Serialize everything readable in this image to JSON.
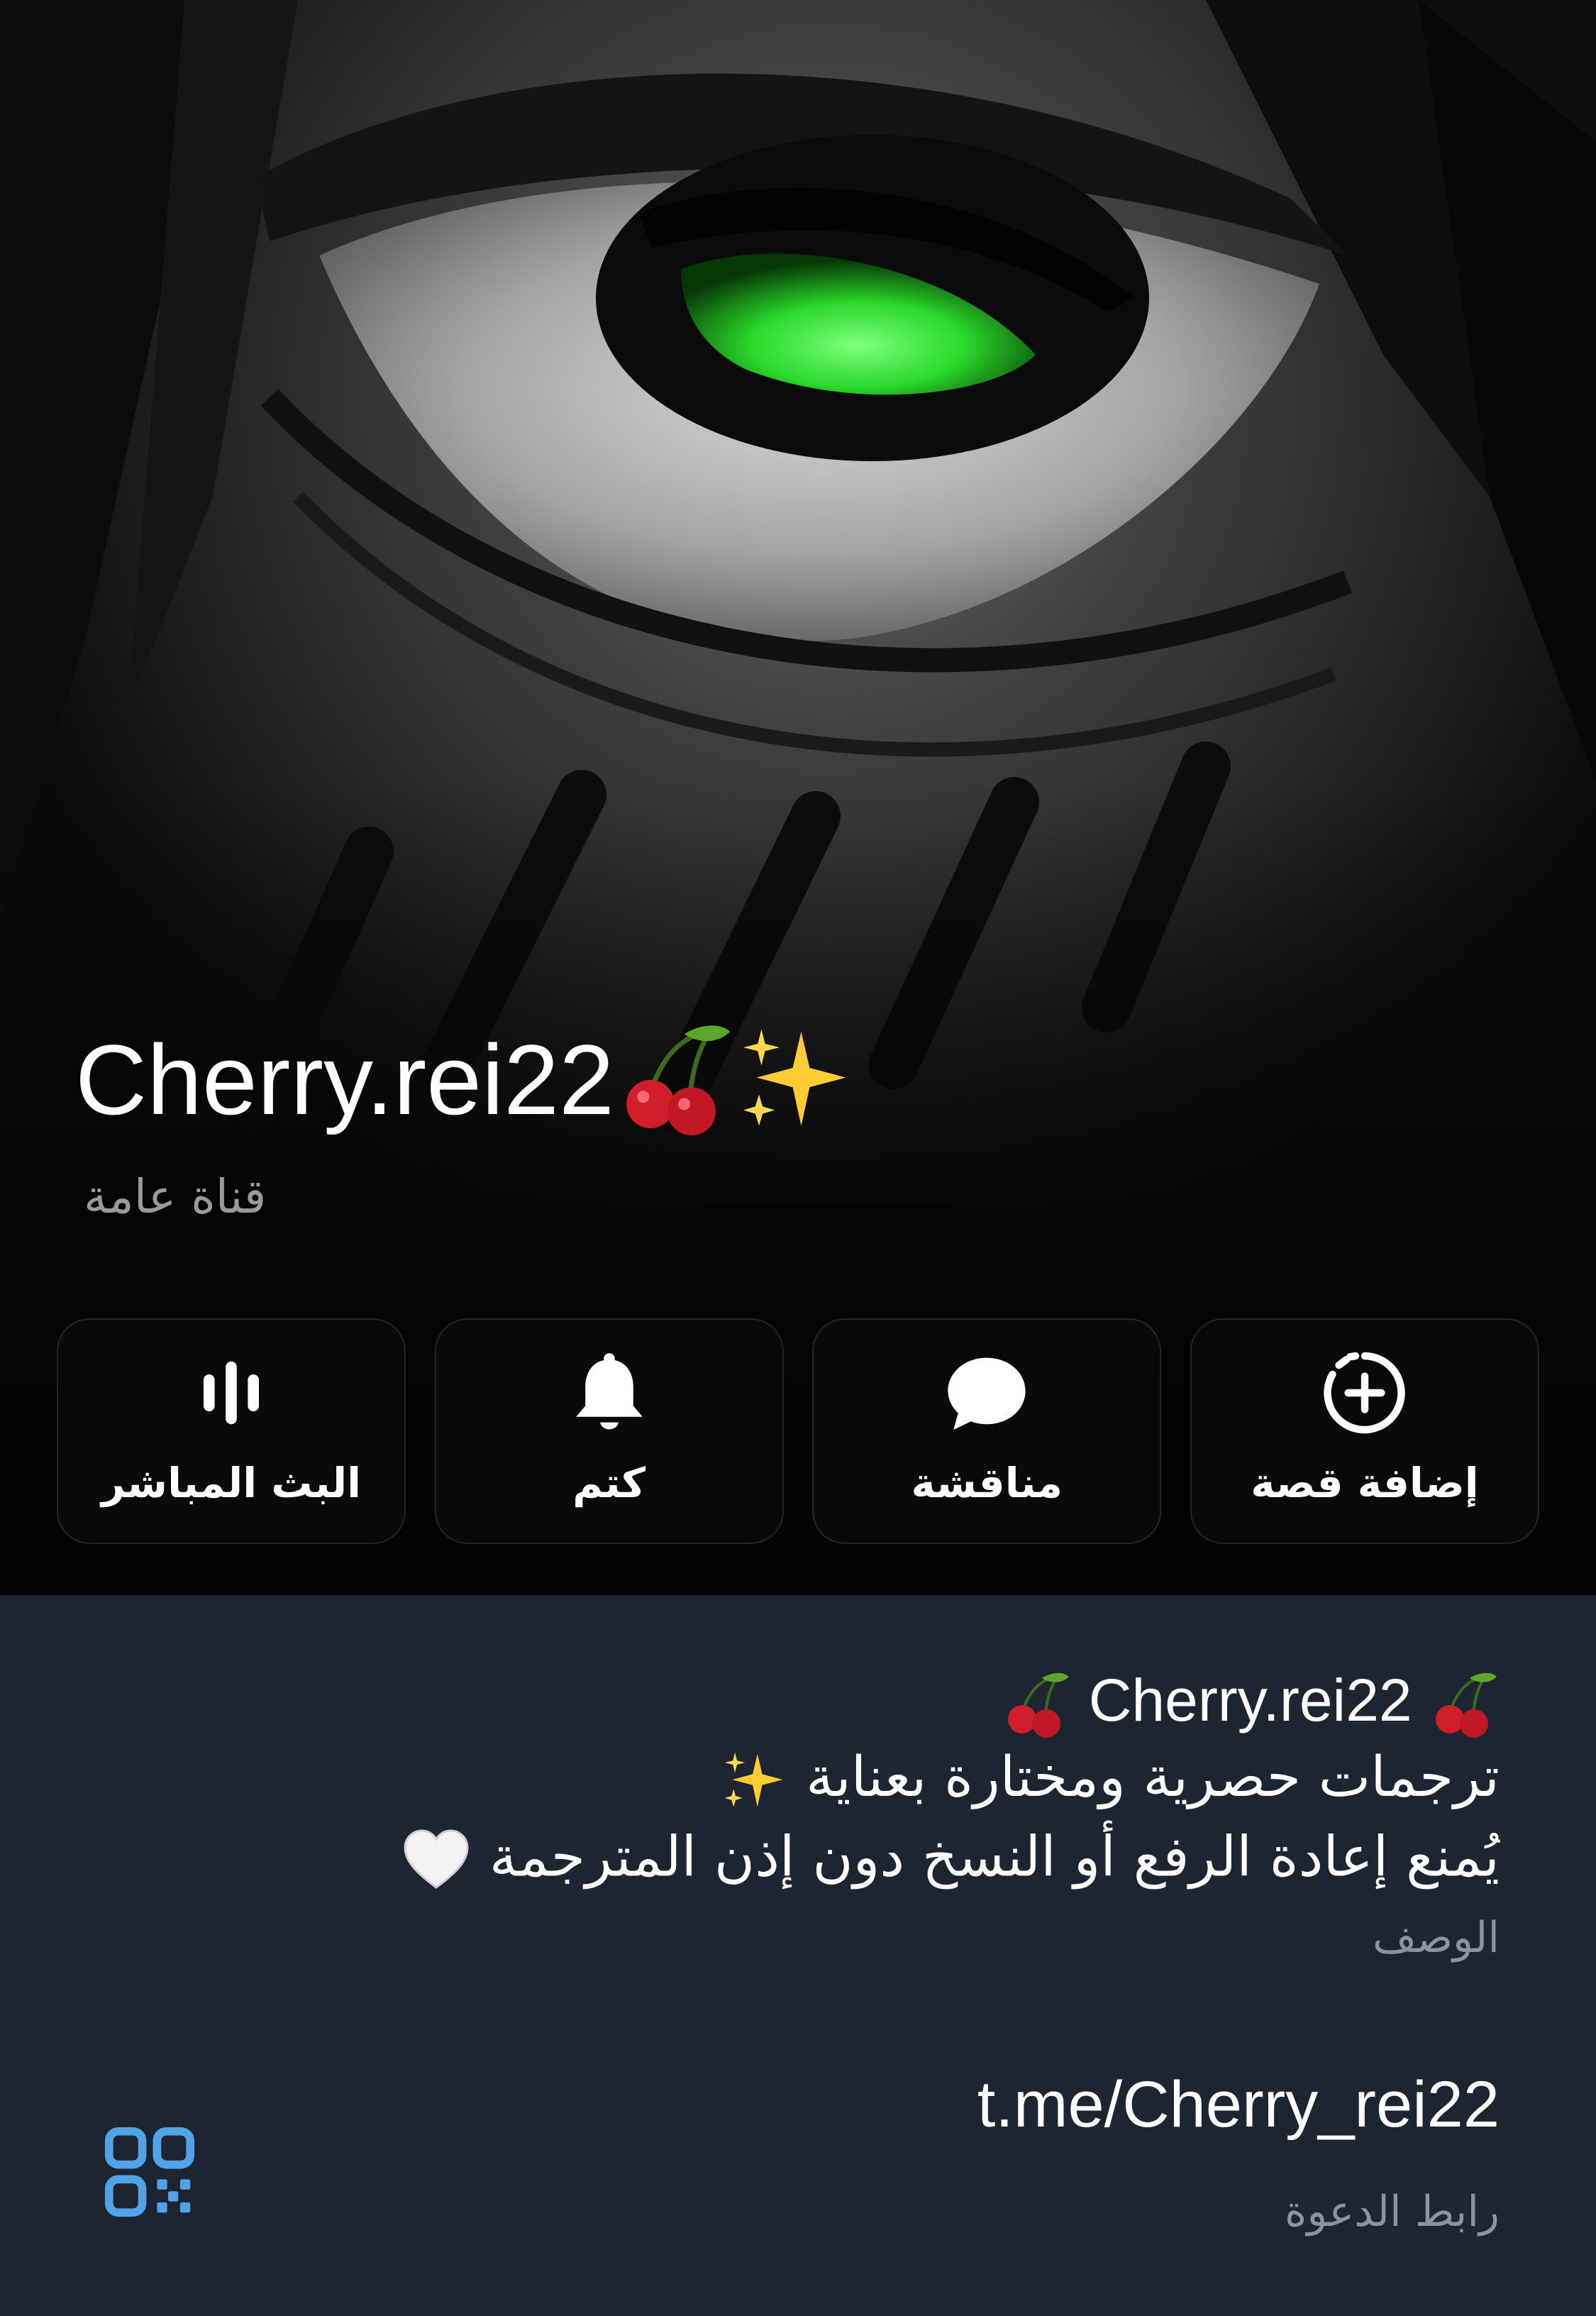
{
  "channel": {
    "name": "Cherry.rei22",
    "type_label": "قناة عامة",
    "title_emojis": [
      "cherry-emoji",
      "sparkles-emoji"
    ]
  },
  "actions": [
    {
      "label": "البث المباشر",
      "icon": "live-stream-icon"
    },
    {
      "label": "كتم",
      "icon": "bell-icon"
    },
    {
      "label": "مناقشة",
      "icon": "chat-bubble-icon"
    },
    {
      "label": "إضافة قصة",
      "icon": "add-story-icon"
    }
  ],
  "description": {
    "line1": "Cherry.rei22",
    "line2": "ترجمات حصرية ومختارة بعناية",
    "line3": "يُمنع إعادة الرفع أو النسخ دون إذن المترجمة",
    "label": "الوصف"
  },
  "invite": {
    "link": "t.me/Cherry_rei22",
    "label": "رابط الدعوة"
  },
  "colors": {
    "panel_bg": "#1d2532",
    "accent_qr": "#4fa3e6",
    "eye_green": "#2bd92b"
  }
}
